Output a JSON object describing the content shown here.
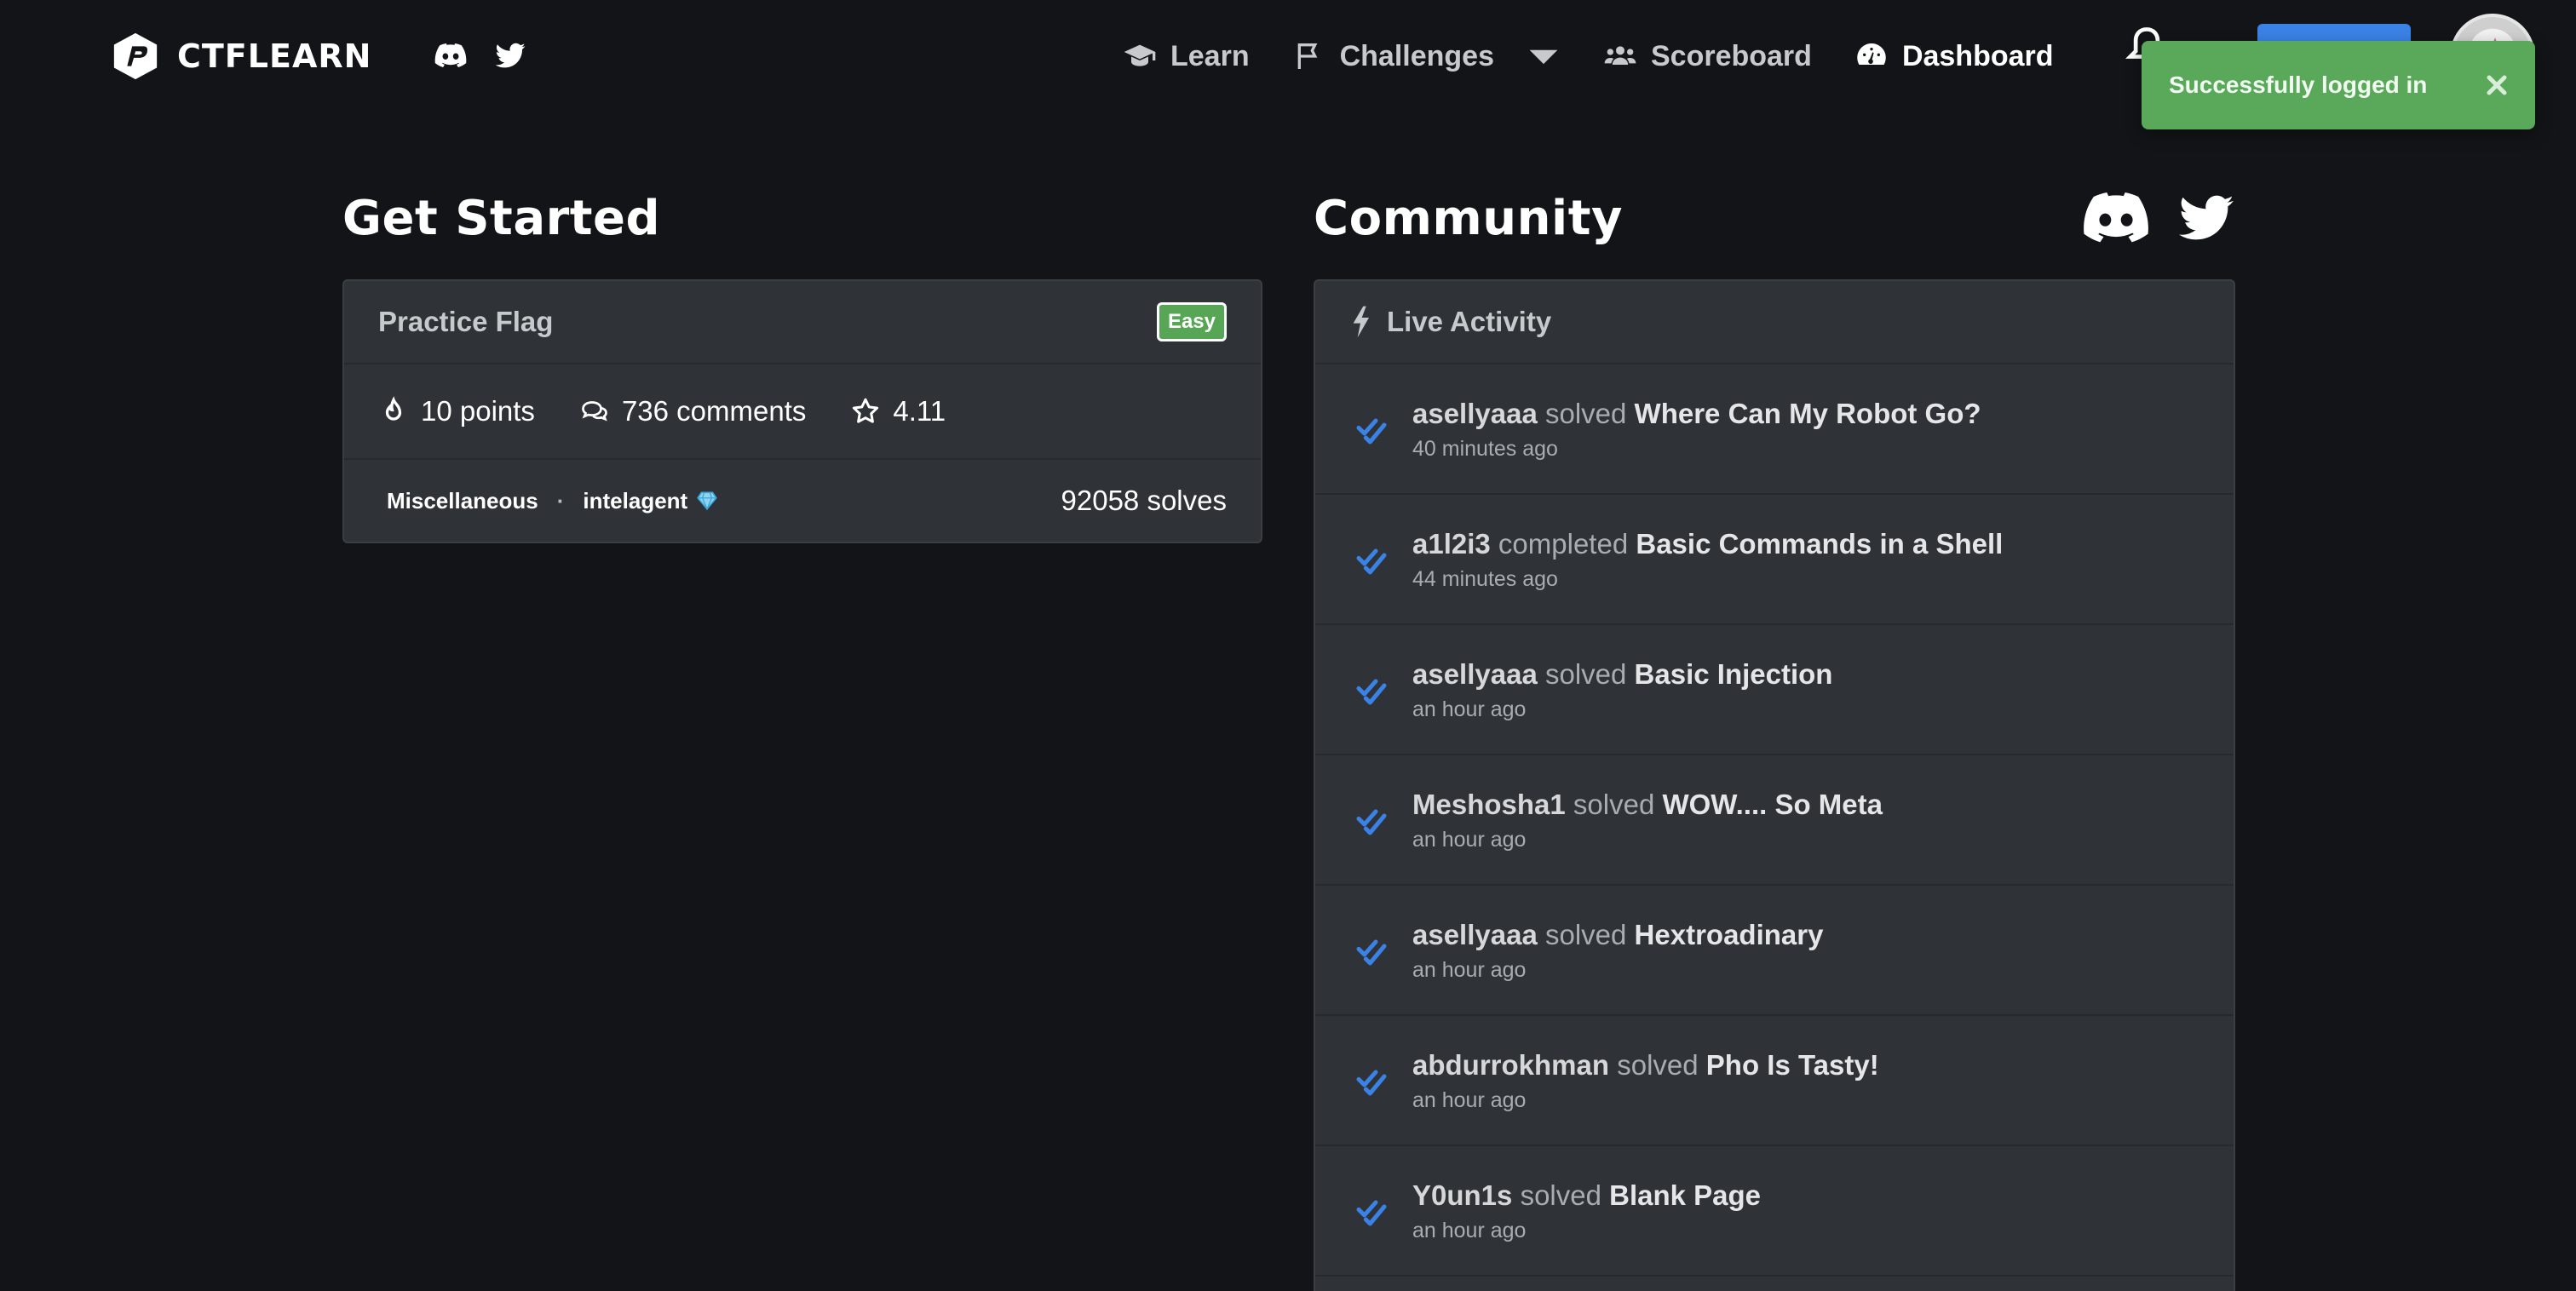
{
  "navbar": {
    "brand": "CTFLEARN",
    "links": [
      {
        "label": "Learn",
        "icon": "graduation-cap-icon"
      },
      {
        "label": "Challenges",
        "icon": "flag-icon"
      },
      {
        "label": "Scoreboard",
        "icon": "users-icon"
      },
      {
        "label": "Dashboard",
        "icon": "gauge-icon"
      }
    ]
  },
  "toast": {
    "message": "Successfully logged in"
  },
  "left": {
    "title": "Get Started",
    "card": {
      "title": "Practice Flag",
      "difficulty": "Easy",
      "points": "10 points",
      "comments": "736 comments",
      "rating": "4.11",
      "category": "Miscellaneous",
      "separator": "·",
      "author": "intelagent",
      "solves": "92058 solves"
    }
  },
  "right": {
    "title": "Community",
    "live_title": "Live Activity",
    "activity": [
      {
        "user": "asellyaaa",
        "verb": "solved",
        "challenge": "Where Can My Robot Go?",
        "time": "40 minutes ago"
      },
      {
        "user": "a1l2i3",
        "verb": "completed",
        "challenge": "Basic Commands in a Shell",
        "time": "44 minutes ago"
      },
      {
        "user": "asellyaaa",
        "verb": "solved",
        "challenge": "Basic Injection",
        "time": "an hour ago"
      },
      {
        "user": "Meshosha1",
        "verb": "solved",
        "challenge": "WOW.... So Meta",
        "time": "an hour ago"
      },
      {
        "user": "asellyaaa",
        "verb": "solved",
        "challenge": "Hextroadinary",
        "time": "an hour ago"
      },
      {
        "user": "abdurrokhman",
        "verb": "solved",
        "challenge": "Pho Is Tasty!",
        "time": "an hour ago"
      },
      {
        "user": "Y0un1s",
        "verb": "solved",
        "challenge": "Blank Page",
        "time": "an hour ago"
      }
    ]
  },
  "colors": {
    "background": "#131417",
    "card": "#2f3337",
    "toast": "#5aa85a",
    "check": "#3b82e6",
    "easy_badge": "#56a656"
  }
}
